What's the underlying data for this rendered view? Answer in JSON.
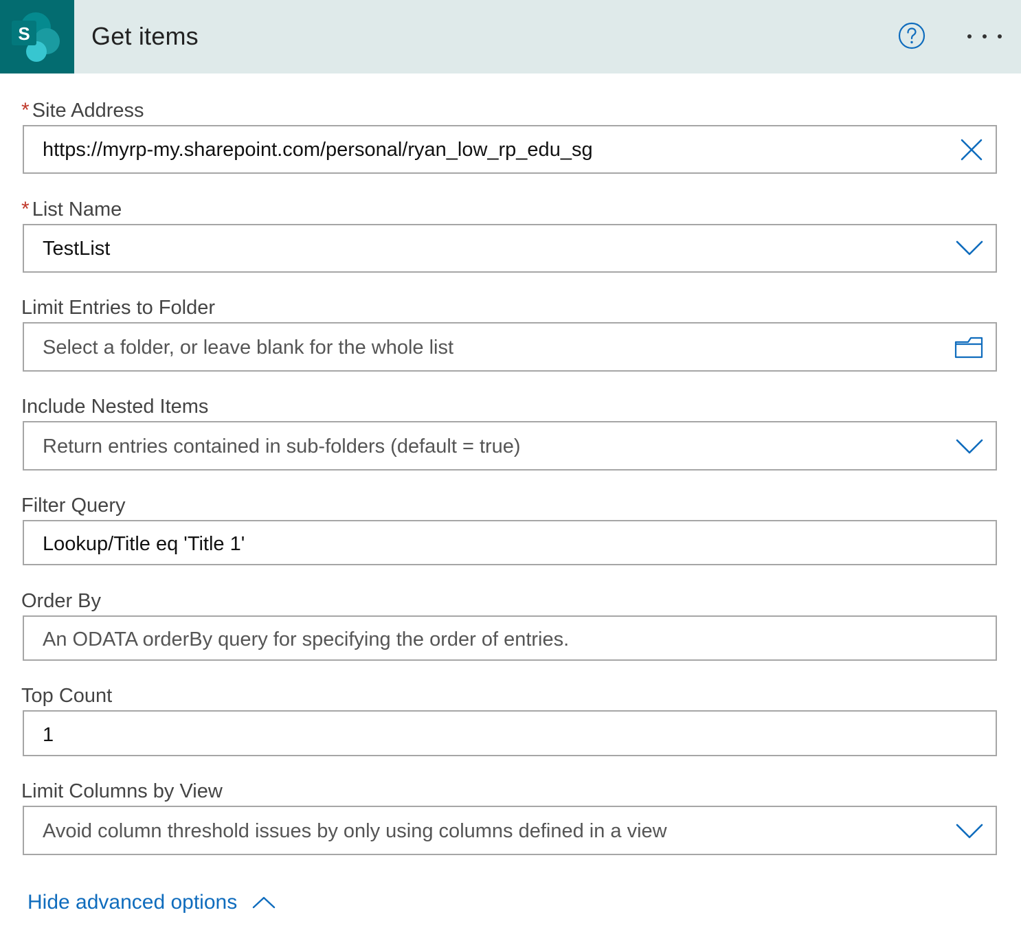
{
  "header": {
    "title": "Get items",
    "logo_letter": "S",
    "logo_icon": "sharepoint-icon",
    "help_icon": "help-circle-icon",
    "more_icon": "more-horizontal-icon",
    "colors": {
      "header_bg": "#dfeaea",
      "logo_bg": "#036c70",
      "accent": "#0f6cbd",
      "required": "#c0392b"
    }
  },
  "fields": {
    "site_address": {
      "label": "Site Address",
      "required_mark": "*",
      "value": "https://myrp-my.sharepoint.com/personal/ryan_low_rp_edu_sg",
      "icon": "clear-icon"
    },
    "list_name": {
      "label": "List Name",
      "required_mark": "*",
      "value": "TestList",
      "icon": "chevron-down-icon"
    },
    "limit_folder": {
      "label": "Limit Entries to Folder",
      "placeholder": "Select a folder, or leave blank for the whole list",
      "icon": "folder-icon"
    },
    "nested_items": {
      "label": "Include Nested Items",
      "placeholder": "Return entries contained in sub-folders (default = true)",
      "icon": "chevron-down-icon"
    },
    "filter_query": {
      "label": "Filter Query",
      "value": "Lookup/Title eq 'Title 1'"
    },
    "order_by": {
      "label": "Order By",
      "placeholder": "An ODATA orderBy query for specifying the order of entries."
    },
    "top_count": {
      "label": "Top Count",
      "value": "1"
    },
    "limit_columns": {
      "label": "Limit Columns by View",
      "placeholder": "Avoid column threshold issues by only using columns defined in a view",
      "icon": "chevron-down-icon"
    }
  },
  "footer": {
    "advanced_label": "Hide advanced options",
    "advanced_icon": "chevron-up-icon"
  }
}
